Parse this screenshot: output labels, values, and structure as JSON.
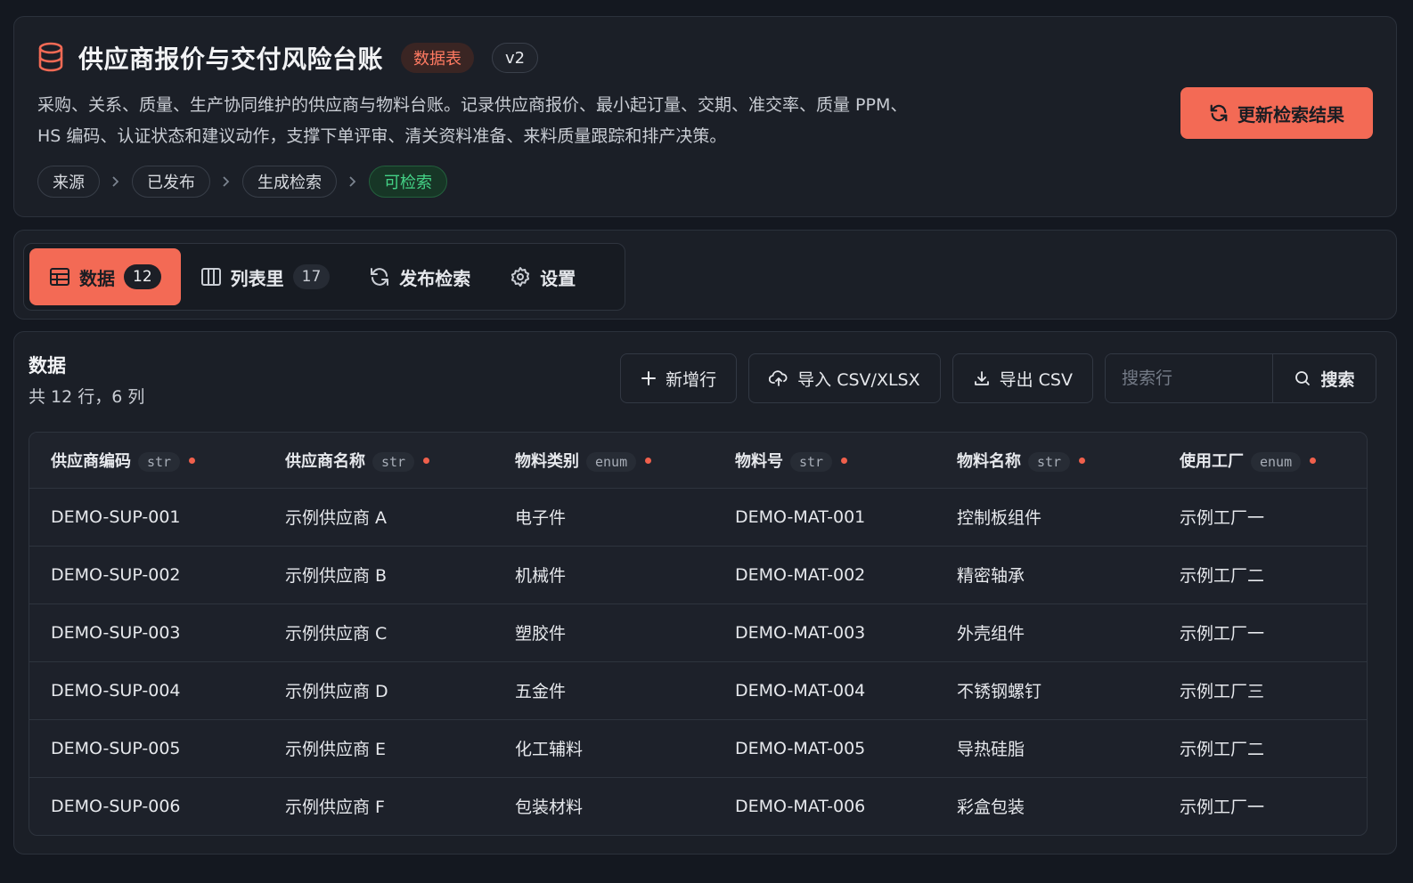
{
  "header": {
    "title": "供应商报价与交付风险台账",
    "badge_type": "数据表",
    "badge_version": "v2",
    "description_line1": "采购、关系、质量、生产协同维护的供应商与物料台账。记录供应商报价、最小起订量、交期、准交率、质量 PPM、",
    "description_line2": "HS 编码、认证状态和建议动作，支撑下单评审、清关资料准备、来料质量跟踪和排产决策。",
    "refresh_label": "更新检索结果",
    "steps": [
      "来源",
      "已发布",
      "生成检索",
      "可检索"
    ],
    "accent_color": "#f36a55",
    "ready_color": "#44d286"
  },
  "tabs": [
    {
      "label": "数据",
      "count": "12",
      "icon": "table-icon"
    },
    {
      "label": "列表里",
      "count": "17",
      "icon": "columns-icon"
    },
    {
      "label": "发布检索",
      "icon": "sync-icon"
    },
    {
      "label": "设置",
      "icon": "gear-icon"
    }
  ],
  "data_section": {
    "title": "数据",
    "subtitle": "共 12 行，6 列",
    "add_row_label": "新增行",
    "import_label": "导入 CSV/XLSX",
    "export_label": "导出 CSV",
    "search_placeholder": "搜索行",
    "search_label": "搜索"
  },
  "table": {
    "columns": [
      {
        "name": "供应商编码",
        "type": "str"
      },
      {
        "name": "供应商名称",
        "type": "str"
      },
      {
        "name": "物料类别",
        "type": "enum"
      },
      {
        "name": "物料号",
        "type": "str"
      },
      {
        "name": "物料名称",
        "type": "str"
      },
      {
        "name": "使用工厂",
        "type": "enum"
      }
    ],
    "rows": [
      [
        "DEMO-SUP-001",
        "示例供应商 A",
        "电子件",
        "DEMO-MAT-001",
        "控制板组件",
        "示例工厂一"
      ],
      [
        "DEMO-SUP-002",
        "示例供应商 B",
        "机械件",
        "DEMO-MAT-002",
        "精密轴承",
        "示例工厂二"
      ],
      [
        "DEMO-SUP-003",
        "示例供应商 C",
        "塑胶件",
        "DEMO-MAT-003",
        "外壳组件",
        "示例工厂一"
      ],
      [
        "DEMO-SUP-004",
        "示例供应商 D",
        "五金件",
        "DEMO-MAT-004",
        "不锈钢螺钉",
        "示例工厂三"
      ],
      [
        "DEMO-SUP-005",
        "示例供应商 E",
        "化工辅料",
        "DEMO-MAT-005",
        "导热硅脂",
        "示例工厂二"
      ],
      [
        "DEMO-SUP-006",
        "示例供应商 F",
        "包装材料",
        "DEMO-MAT-006",
        "彩盒包装",
        "示例工厂一"
      ]
    ]
  }
}
